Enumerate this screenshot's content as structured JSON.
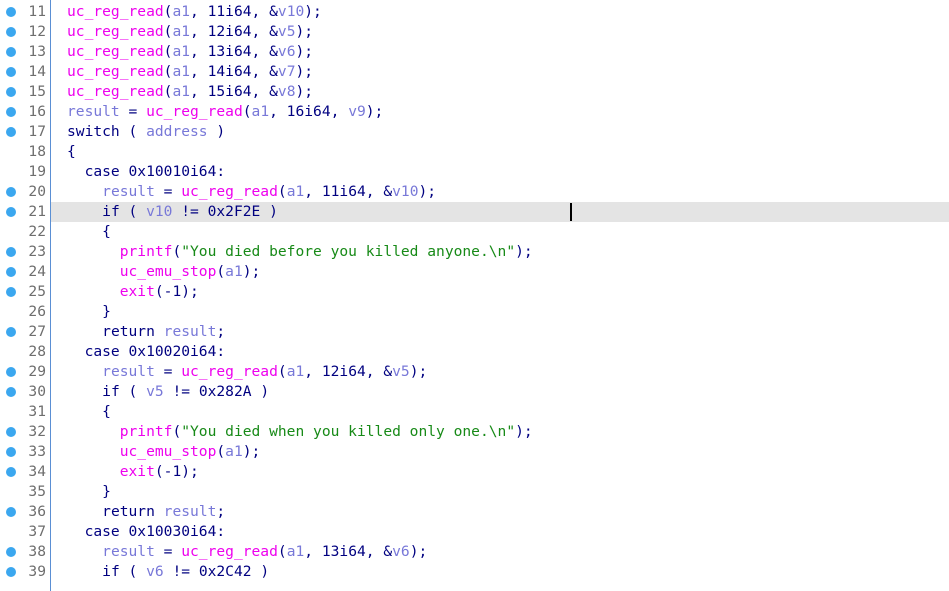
{
  "editor": {
    "highlighted_line": 21,
    "colors": {
      "func": "#ee00ee",
      "var": "#7878d8",
      "str": "#178a17",
      "txt": "#000080",
      "breakpoint": "#3ba7ef",
      "highlight": "#e4e4e4"
    },
    "lines": [
      {
        "n": "11",
        "bp": true,
        "indent": 0,
        "tokens": [
          [
            "func",
            "uc_reg_read"
          ],
          [
            "txt",
            "("
          ],
          [
            "var",
            "a1"
          ],
          [
            "txt",
            ", 11i64, &"
          ],
          [
            "var",
            "v10"
          ],
          [
            "txt",
            ");"
          ]
        ]
      },
      {
        "n": "12",
        "bp": true,
        "indent": 0,
        "tokens": [
          [
            "func",
            "uc_reg_read"
          ],
          [
            "txt",
            "("
          ],
          [
            "var",
            "a1"
          ],
          [
            "txt",
            ", 12i64, &"
          ],
          [
            "var",
            "v5"
          ],
          [
            "txt",
            ");"
          ]
        ]
      },
      {
        "n": "13",
        "bp": true,
        "indent": 0,
        "tokens": [
          [
            "func",
            "uc_reg_read"
          ],
          [
            "txt",
            "("
          ],
          [
            "var",
            "a1"
          ],
          [
            "txt",
            ", 13i64, &"
          ],
          [
            "var",
            "v6"
          ],
          [
            "txt",
            ");"
          ]
        ]
      },
      {
        "n": "14",
        "bp": true,
        "indent": 0,
        "tokens": [
          [
            "func",
            "uc_reg_read"
          ],
          [
            "txt",
            "("
          ],
          [
            "var",
            "a1"
          ],
          [
            "txt",
            ", 14i64, &"
          ],
          [
            "var",
            "v7"
          ],
          [
            "txt",
            ");"
          ]
        ]
      },
      {
        "n": "15",
        "bp": true,
        "indent": 0,
        "tokens": [
          [
            "func",
            "uc_reg_read"
          ],
          [
            "txt",
            "("
          ],
          [
            "var",
            "a1"
          ],
          [
            "txt",
            ", 15i64, &"
          ],
          [
            "var",
            "v8"
          ],
          [
            "txt",
            ");"
          ]
        ]
      },
      {
        "n": "16",
        "bp": true,
        "indent": 0,
        "tokens": [
          [
            "var",
            "result"
          ],
          [
            "txt",
            " = "
          ],
          [
            "func",
            "uc_reg_read"
          ],
          [
            "txt",
            "("
          ],
          [
            "var",
            "a1"
          ],
          [
            "txt",
            ", 16i64, "
          ],
          [
            "var",
            "v9"
          ],
          [
            "txt",
            ");"
          ]
        ]
      },
      {
        "n": "17",
        "bp": true,
        "indent": 0,
        "tokens": [
          [
            "txt",
            "switch ( "
          ],
          [
            "var",
            "address"
          ],
          [
            "txt",
            " )"
          ]
        ]
      },
      {
        "n": "18",
        "bp": false,
        "indent": 0,
        "tokens": [
          [
            "txt",
            "{"
          ]
        ]
      },
      {
        "n": "19",
        "bp": false,
        "indent": 1,
        "tokens": [
          [
            "txt",
            "case 0x10010i64:"
          ]
        ]
      },
      {
        "n": "20",
        "bp": true,
        "indent": 2,
        "tokens": [
          [
            "var",
            "result"
          ],
          [
            "txt",
            " = "
          ],
          [
            "func",
            "uc_reg_read"
          ],
          [
            "txt",
            "("
          ],
          [
            "var",
            "a1"
          ],
          [
            "txt",
            ", 11i64, &"
          ],
          [
            "var",
            "v10"
          ],
          [
            "txt",
            ");"
          ]
        ]
      },
      {
        "n": "21",
        "bp": true,
        "indent": 2,
        "tokens": [
          [
            "txt",
            "if ( "
          ],
          [
            "var",
            "v10"
          ],
          [
            "txt",
            " != 0x2F2E )"
          ]
        ]
      },
      {
        "n": "22",
        "bp": false,
        "indent": 2,
        "tokens": [
          [
            "txt",
            "{"
          ]
        ]
      },
      {
        "n": "23",
        "bp": true,
        "indent": 3,
        "tokens": [
          [
            "func",
            "printf"
          ],
          [
            "txt",
            "("
          ],
          [
            "str",
            "\"You died before you killed anyone.\\n\""
          ],
          [
            "txt",
            ");"
          ]
        ]
      },
      {
        "n": "24",
        "bp": true,
        "indent": 3,
        "tokens": [
          [
            "func",
            "uc_emu_stop"
          ],
          [
            "txt",
            "("
          ],
          [
            "var",
            "a1"
          ],
          [
            "txt",
            ");"
          ]
        ]
      },
      {
        "n": "25",
        "bp": true,
        "indent": 3,
        "tokens": [
          [
            "func",
            "exit"
          ],
          [
            "txt",
            "(-1);"
          ]
        ]
      },
      {
        "n": "26",
        "bp": false,
        "indent": 2,
        "tokens": [
          [
            "txt",
            "}"
          ]
        ]
      },
      {
        "n": "27",
        "bp": true,
        "indent": 2,
        "tokens": [
          [
            "txt",
            "return "
          ],
          [
            "var",
            "result"
          ],
          [
            "txt",
            ";"
          ]
        ]
      },
      {
        "n": "28",
        "bp": false,
        "indent": 1,
        "tokens": [
          [
            "txt",
            "case 0x10020i64:"
          ]
        ]
      },
      {
        "n": "29",
        "bp": true,
        "indent": 2,
        "tokens": [
          [
            "var",
            "result"
          ],
          [
            "txt",
            " = "
          ],
          [
            "func",
            "uc_reg_read"
          ],
          [
            "txt",
            "("
          ],
          [
            "var",
            "a1"
          ],
          [
            "txt",
            ", 12i64, &"
          ],
          [
            "var",
            "v5"
          ],
          [
            "txt",
            ");"
          ]
        ]
      },
      {
        "n": "30",
        "bp": true,
        "indent": 2,
        "tokens": [
          [
            "txt",
            "if ( "
          ],
          [
            "var",
            "v5"
          ],
          [
            "txt",
            " != 0x282A )"
          ]
        ]
      },
      {
        "n": "31",
        "bp": false,
        "indent": 2,
        "tokens": [
          [
            "txt",
            "{"
          ]
        ]
      },
      {
        "n": "32",
        "bp": true,
        "indent": 3,
        "tokens": [
          [
            "func",
            "printf"
          ],
          [
            "txt",
            "("
          ],
          [
            "str",
            "\"You died when you killed only one.\\n\""
          ],
          [
            "txt",
            ");"
          ]
        ]
      },
      {
        "n": "33",
        "bp": true,
        "indent": 3,
        "tokens": [
          [
            "func",
            "uc_emu_stop"
          ],
          [
            "txt",
            "("
          ],
          [
            "var",
            "a1"
          ],
          [
            "txt",
            ");"
          ]
        ]
      },
      {
        "n": "34",
        "bp": true,
        "indent": 3,
        "tokens": [
          [
            "func",
            "exit"
          ],
          [
            "txt",
            "(-1);"
          ]
        ]
      },
      {
        "n": "35",
        "bp": false,
        "indent": 2,
        "tokens": [
          [
            "txt",
            "}"
          ]
        ]
      },
      {
        "n": "36",
        "bp": true,
        "indent": 2,
        "tokens": [
          [
            "txt",
            "return "
          ],
          [
            "var",
            "result"
          ],
          [
            "txt",
            ";"
          ]
        ]
      },
      {
        "n": "37",
        "bp": false,
        "indent": 1,
        "tokens": [
          [
            "txt",
            "case 0x10030i64:"
          ]
        ]
      },
      {
        "n": "38",
        "bp": true,
        "indent": 2,
        "tokens": [
          [
            "var",
            "result"
          ],
          [
            "txt",
            " = "
          ],
          [
            "func",
            "uc_reg_read"
          ],
          [
            "txt",
            "("
          ],
          [
            "var",
            "a1"
          ],
          [
            "txt",
            ", 13i64, &"
          ],
          [
            "var",
            "v6"
          ],
          [
            "txt",
            ");"
          ]
        ]
      },
      {
        "n": "39",
        "bp": true,
        "indent": 2,
        "tokens": [
          [
            "txt",
            "if ( "
          ],
          [
            "var",
            "v6"
          ],
          [
            "txt",
            " != 0x2C42 )"
          ]
        ]
      }
    ]
  }
}
